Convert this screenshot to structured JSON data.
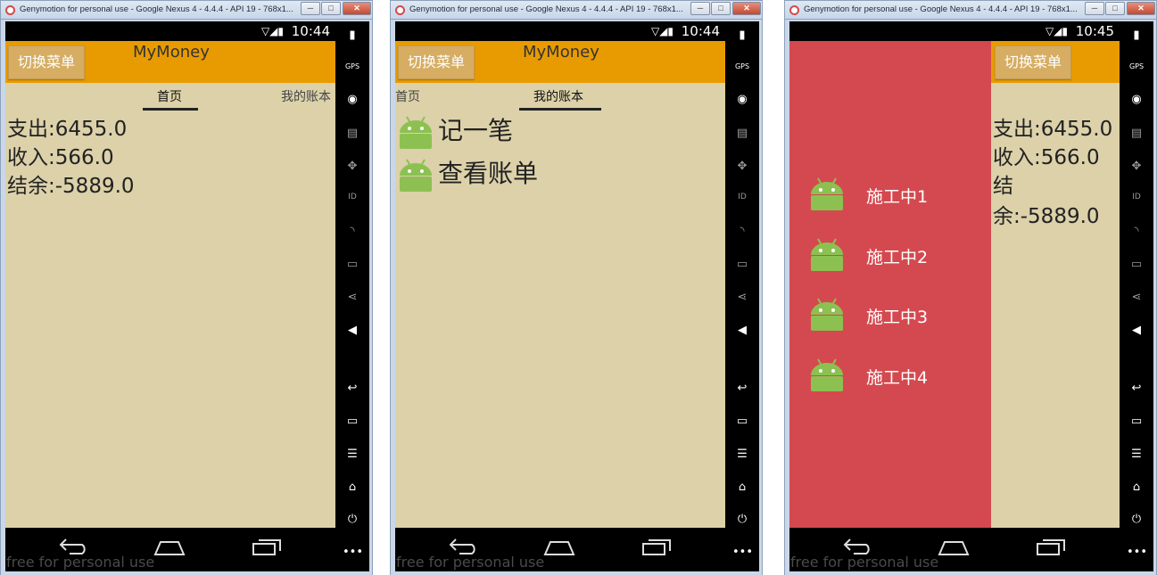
{
  "window_title": "Genymotion for personal use - Google Nexus 4 - 4.4.4 - API 19 - 768x1...",
  "window_buttons": {
    "minimize": "─",
    "maximize": "□",
    "close": "✕"
  },
  "status": {
    "time_1": "10:44",
    "time_2": "10:44",
    "time_3": "10:45",
    "icons": "▽◢▮"
  },
  "app": {
    "title": "MyMoney",
    "menu_button": "切换菜单"
  },
  "tabs": {
    "home": "首页",
    "my_account": "我的账本"
  },
  "stats": {
    "expense": "支出:6455.0",
    "income": "收入:566.0",
    "balance": "结余:-5889.0"
  },
  "account_list": [
    {
      "label": "记一笔",
      "icon": "android-robot-icon"
    },
    {
      "label": "查看账单",
      "icon": "android-robot-icon"
    }
  ],
  "drawer_items": [
    {
      "label": "施工中1"
    },
    {
      "label": "施工中2"
    },
    {
      "label": "施工中3"
    },
    {
      "label": "施工中4"
    }
  ],
  "watermark": "free for personal use",
  "nav_icons": {
    "back": "back-icon",
    "home": "home-icon",
    "recents": "recents-icon"
  },
  "sidebar_icons": [
    "battery-icon",
    "gps-icon",
    "camera-icon",
    "clapper-icon",
    "dpad-icon",
    "id-icon",
    "rss-icon",
    "sms-icon",
    "share-icon",
    "volume-icon",
    "back-icon",
    "recents-icon",
    "menu-icon",
    "home-icon",
    "power-icon",
    "more-icon"
  ],
  "colors": {
    "actionbar": "#e89b00",
    "content_bg": "#dcd1a9",
    "drawer": "#d4494f",
    "android_green": "#8cc152"
  }
}
